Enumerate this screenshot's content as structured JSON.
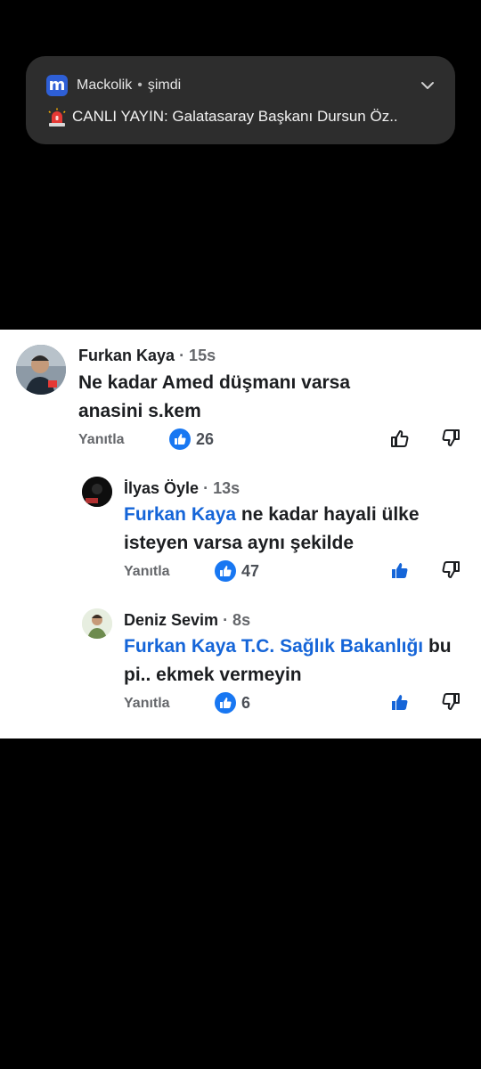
{
  "notification": {
    "app_icon_letter": "m",
    "app_name": "Mackolik",
    "separator": "•",
    "time": "şimdi",
    "alert_icon": "rotating-light-icon",
    "body": "CANLI YAYIN: Galatasaray Başkanı Dursun Öz.."
  },
  "comments": [
    {
      "author": "Furkan Kaya",
      "time": "· 15s",
      "text": "Ne kadar Amed düşmanı varsa anasini s.kem",
      "reply_label": "Yanıtla",
      "like_count": "26",
      "liked": false
    },
    {
      "author": "İlyas Öyle",
      "time": "· 13s",
      "mention": "Furkan Kaya",
      "text": "ne kadar hayali ülke isteyen varsa aynı şekilde",
      "reply_label": "Yanıtla",
      "like_count": "47",
      "liked": true
    },
    {
      "author": "Deniz Sevim",
      "time": "· 8s",
      "mention": "Furkan Kaya",
      "mention2": "T.C. Sağlık Bakanlığı",
      "text": "bu pi.. ekmek vermeyin",
      "reply_label": "Yanıtla",
      "like_count": "6",
      "liked": true
    }
  ],
  "colors": {
    "accent": "#1565d8",
    "text": "#1c1e21",
    "muted": "#65676b",
    "notification_bg": "#2d2d2d"
  }
}
